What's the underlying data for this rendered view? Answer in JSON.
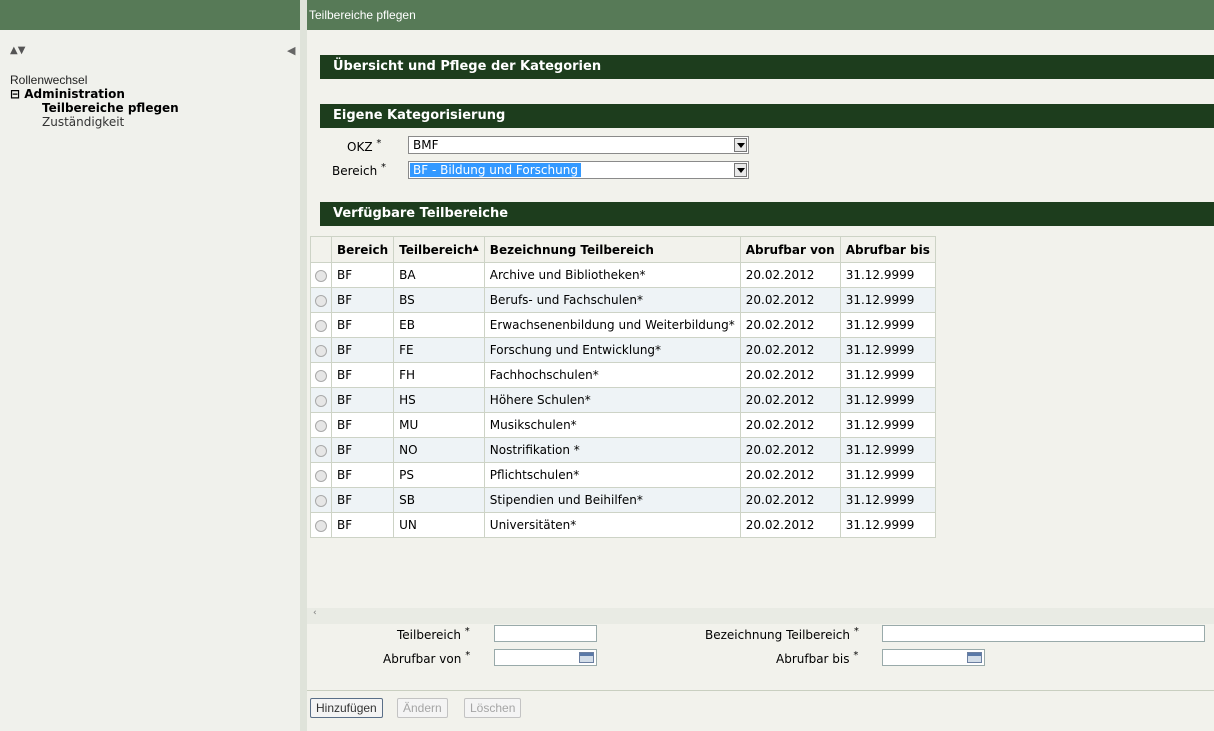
{
  "header": {
    "title": "Teilbereiche pflegen"
  },
  "sidebar": {
    "sort_icons": "▲▼",
    "collapse_glyph": "◀",
    "items": [
      {
        "label": "Rollenwechsel"
      },
      {
        "label": "Administration",
        "toggle": "⊟"
      },
      {
        "label": "Teilbereiche pflegen"
      },
      {
        "label": "Zuständigkeit"
      }
    ]
  },
  "sections": {
    "overview": "Übersicht und Pflege der Kategorien",
    "own": "Eigene Kategorisierung",
    "available": "Verfügbare Teilbereiche"
  },
  "form": {
    "okz_label": "OKZ",
    "okz_value": "BMF",
    "bereich_label": "Bereich",
    "bereich_value": "BF - Bildung und Forschung",
    "required_mark": "*"
  },
  "table": {
    "columns": [
      "Bereich",
      "Teilbereich",
      "Bezeichnung Teilbereich",
      "Abrufbar von",
      "Abrufbar bis"
    ],
    "sort_indicator": "▲",
    "rows": [
      [
        "BF",
        "BA",
        "Archive und Bibliotheken*",
        "20.02.2012",
        "31.12.9999"
      ],
      [
        "BF",
        "BS",
        "Berufs- und Fachschulen*",
        "20.02.2012",
        "31.12.9999"
      ],
      [
        "BF",
        "EB",
        "Erwachsenenbildung und Weiterbildung*",
        "20.02.2012",
        "31.12.9999"
      ],
      [
        "BF",
        "FE",
        "Forschung und Entwicklung*",
        "20.02.2012",
        "31.12.9999"
      ],
      [
        "BF",
        "FH",
        "Fachhochschulen*",
        "20.02.2012",
        "31.12.9999"
      ],
      [
        "BF",
        "HS",
        "Höhere Schulen*",
        "20.02.2012",
        "31.12.9999"
      ],
      [
        "BF",
        "MU",
        "Musikschulen*",
        "20.02.2012",
        "31.12.9999"
      ],
      [
        "BF",
        "NO",
        "Nostrifikation *",
        "20.02.2012",
        "31.12.9999"
      ],
      [
        "BF",
        "PS",
        "Pflichtschulen*",
        "20.02.2012",
        "31.12.9999"
      ],
      [
        "BF",
        "SB",
        "Stipendien und Beihilfen*",
        "20.02.2012",
        "31.12.9999"
      ],
      [
        "BF",
        "UN",
        "Universitäten*",
        "20.02.2012",
        "31.12.9999"
      ]
    ]
  },
  "scroll_glyph": "‹",
  "edit": {
    "teilbereich_label": "Teilbereich",
    "bezeichnung_label": "Bezeichnung Teilbereich",
    "von_label": "Abrufbar von",
    "bis_label": "Abrufbar bis"
  },
  "buttons": {
    "add": "Hinzufügen",
    "change": "Ändern",
    "delete": "Löschen"
  },
  "colors": {
    "header": "#577a57",
    "section": "#1d3d1d",
    "highlight": "#3399ff"
  }
}
